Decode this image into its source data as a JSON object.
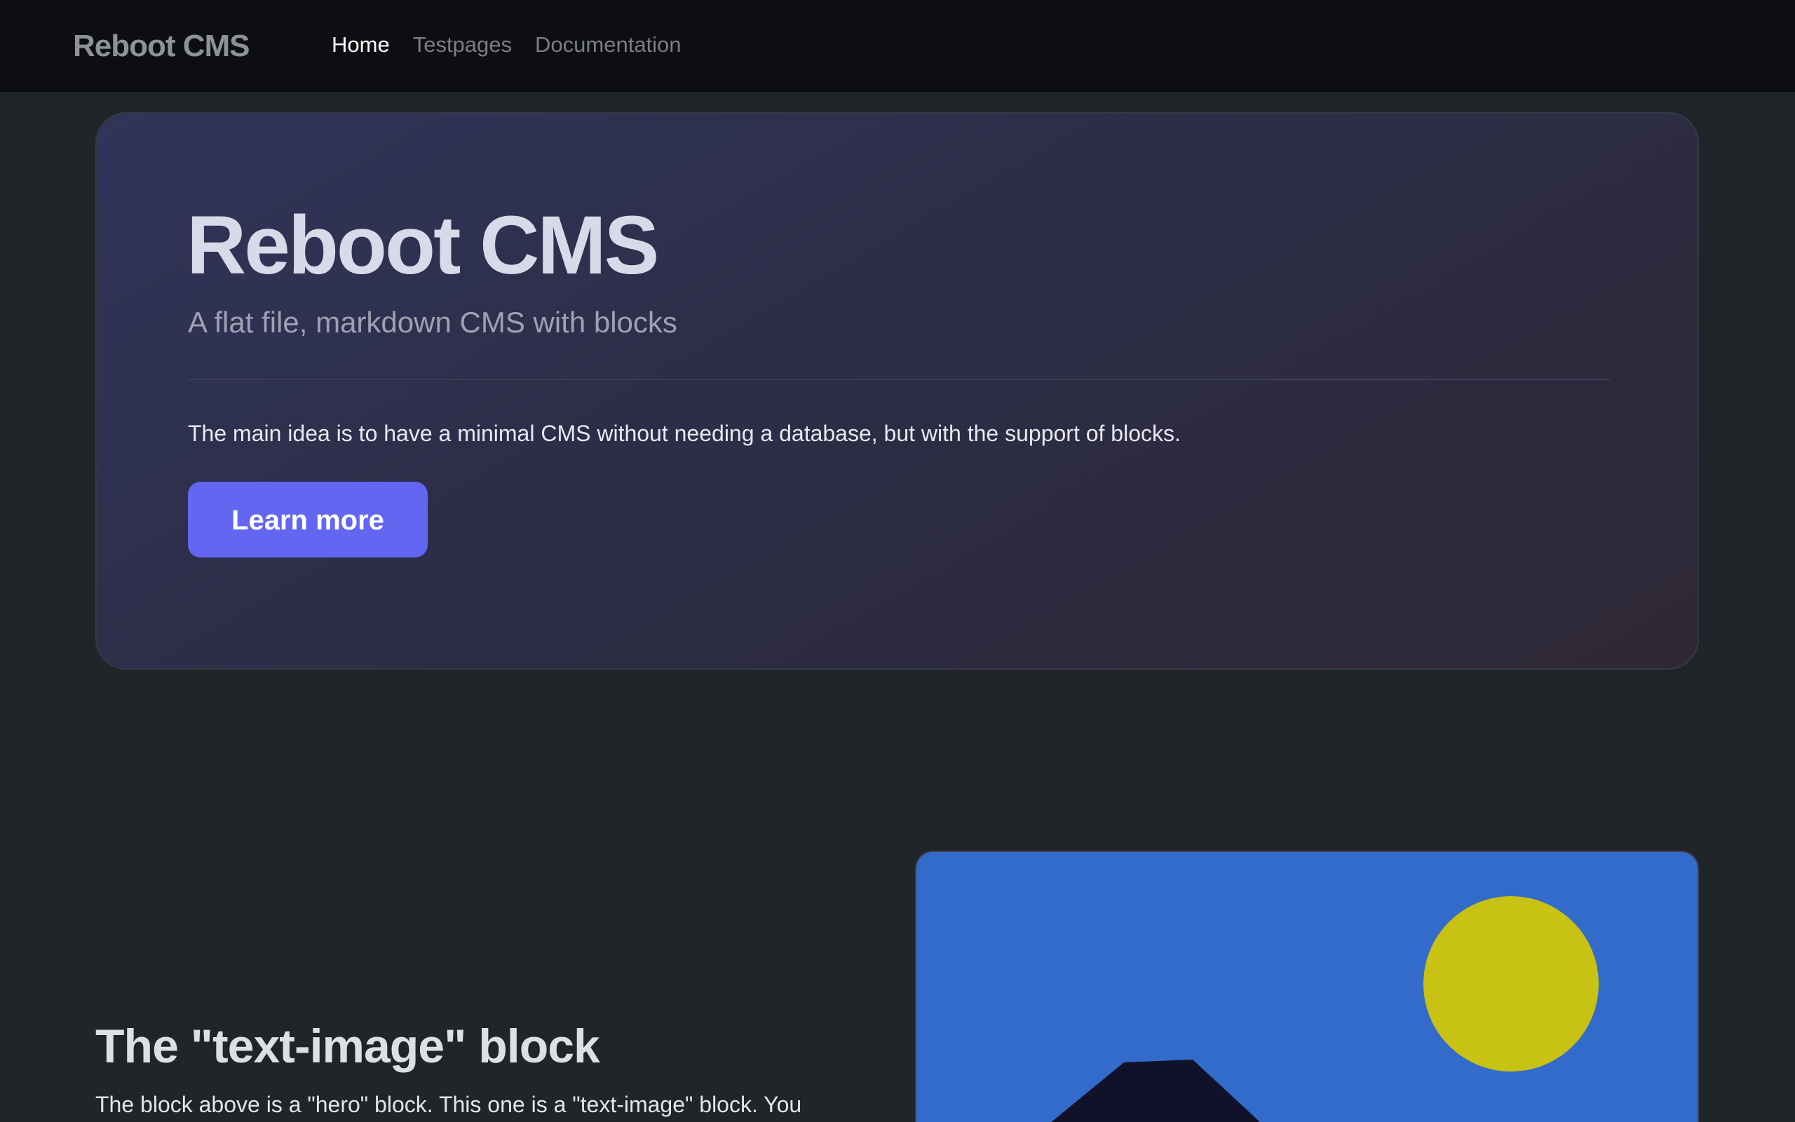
{
  "navbar": {
    "brand": "Reboot CMS",
    "links": [
      {
        "label": "Home",
        "active": true
      },
      {
        "label": "Testpages",
        "active": false
      },
      {
        "label": "Documentation",
        "active": false
      }
    ]
  },
  "hero": {
    "title": "Reboot CMS",
    "subtitle": "A flat file, markdown CMS with blocks",
    "text": "The main idea is to have a minimal CMS without needing a database, but with the support of blocks.",
    "button_label": "Learn more"
  },
  "text_image": {
    "heading": "The \"text-image\" block",
    "text": "The block above is a \"hero\" block. This one is a \"text-image\" block. You",
    "image": {
      "icon": "landscape-placeholder-icon",
      "sky_color": "#336bcb",
      "sun_color": "#c7c213",
      "mountain_color": "#11122a"
    }
  },
  "colors": {
    "page_bg": "#212429",
    "navbar_bg": "#0c0e12",
    "accent": "#6366f1"
  }
}
